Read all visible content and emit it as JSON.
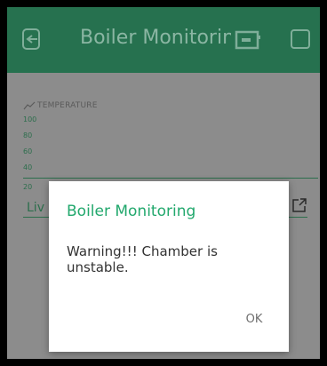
{
  "app_bar": {
    "title": "Boiler Monitorin",
    "back_icon": "exit-icon",
    "device_icon": "device-icon",
    "menu_icon": "square-icon",
    "color": "#26714f"
  },
  "chart_widget": {
    "title": "TEMPERATURE",
    "y_ticks": [
      "100",
      "80",
      "60",
      "40",
      "20"
    ],
    "mode_label": "Liv",
    "accent": "#2c6e4c"
  },
  "dialog": {
    "title": "Boiler Monitoring",
    "message": "Warning!!! Chamber is unstable.",
    "ok_label": "OK",
    "title_color": "#22a86d"
  }
}
